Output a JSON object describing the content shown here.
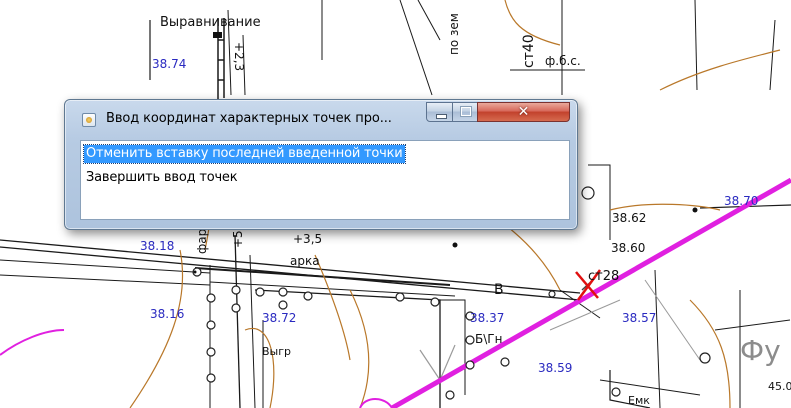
{
  "map": {
    "labels": {
      "alignment": "Выравнивание",
      "plus23": "+2,3",
      "elev_3874": "38.74",
      "po_zem": "по зем",
      "st40": "ст40",
      "fbs": "ф.б.с.",
      "elev_3862": "38.62",
      "elev_3870": "38.70",
      "elev_3818": "38.18",
      "farka": "фарка",
      "plus50": "+5,0",
      "plus35": "+3,5",
      "arka": "арка",
      "elev_3860": "38.60",
      "st28": "ст28",
      "letter_v": "В",
      "elev_3816": "38.16",
      "elev_3872": "38.72",
      "elev_3837": "38.37",
      "elev_3857": "38.57",
      "b_letter": "Б\\Гн",
      "bygr": "Выгр",
      "elev_3859": "38.59",
      "fu": "Фу",
      "val_450": "45.0",
      "emk": "Емк"
    }
  },
  "dialog": {
    "title": "Ввод координат характерных точек про...",
    "close_glyph": "✕",
    "options": [
      "Отменить вставку последней введенной точки",
      "Завершить ввод  точек"
    ],
    "selected_index": 0,
    "colors": {
      "selection": "#3399ff",
      "close_button": "#c2412c",
      "frame": "#b7cbe3"
    }
  }
}
